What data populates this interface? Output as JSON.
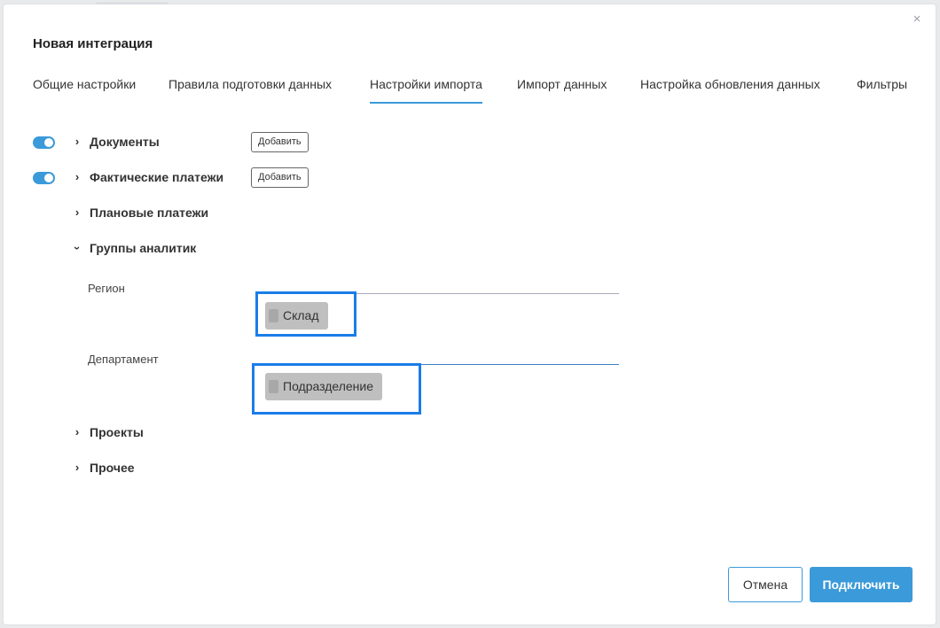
{
  "dialog": {
    "title": "Новая интеграция",
    "close_icon": "close-icon"
  },
  "tabs": [
    {
      "label": "Общие настройки",
      "active": false
    },
    {
      "label": "Правила подготовки данных",
      "active": false
    },
    {
      "label": "Настройки импорта",
      "active": true
    },
    {
      "label": "Импорт данных",
      "active": false
    },
    {
      "label": "Настройка обновления данных",
      "active": false
    },
    {
      "label": "Фильтры",
      "active": false
    }
  ],
  "sections": [
    {
      "label": "Документы",
      "toggle": true,
      "expanded": false,
      "add_label": "Добавить"
    },
    {
      "label": "Фактические платежи",
      "toggle": true,
      "expanded": false,
      "add_label": "Добавить"
    },
    {
      "label": "Плановые платежи",
      "toggle": false,
      "expanded": false
    },
    {
      "label": "Группы аналитик",
      "toggle": false,
      "expanded": true
    },
    {
      "label": "Проекты",
      "toggle": false,
      "expanded": false
    },
    {
      "label": "Прочее",
      "toggle": false,
      "expanded": false
    }
  ],
  "analytics_groups": [
    {
      "label": "Регион",
      "chip": "Склад"
    },
    {
      "label": "Департамент",
      "chip": "Подразделение"
    }
  ],
  "footer": {
    "cancel_label": "Отмена",
    "connect_label": "Подключить"
  },
  "colors": {
    "accent": "#3b9ad9",
    "highlight": "#1a7de8",
    "chip_bg": "#bfbfbf"
  }
}
